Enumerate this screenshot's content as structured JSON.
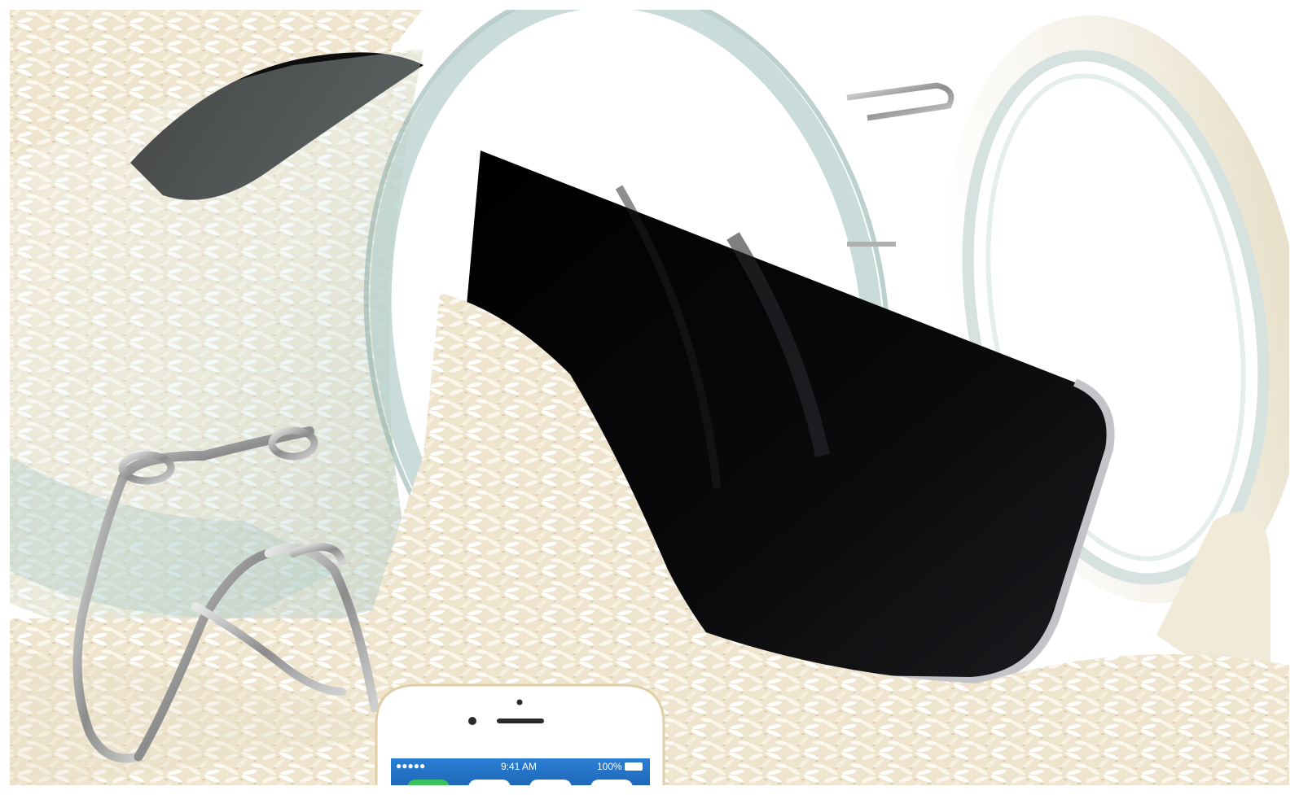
{
  "phone_screen": {
    "time": "9:41 AM",
    "battery": "100%",
    "signal_dots": "●●●●●"
  },
  "colors": {
    "rice": "#f2e9d6",
    "rice_shadow": "#d9ccb0",
    "glass_edge": "#9fbfbf",
    "phone_black": "#050505",
    "phone_silver": "#b9b9bd",
    "screen_blue": "#2a7fd4",
    "app_green": "#39c15a"
  }
}
